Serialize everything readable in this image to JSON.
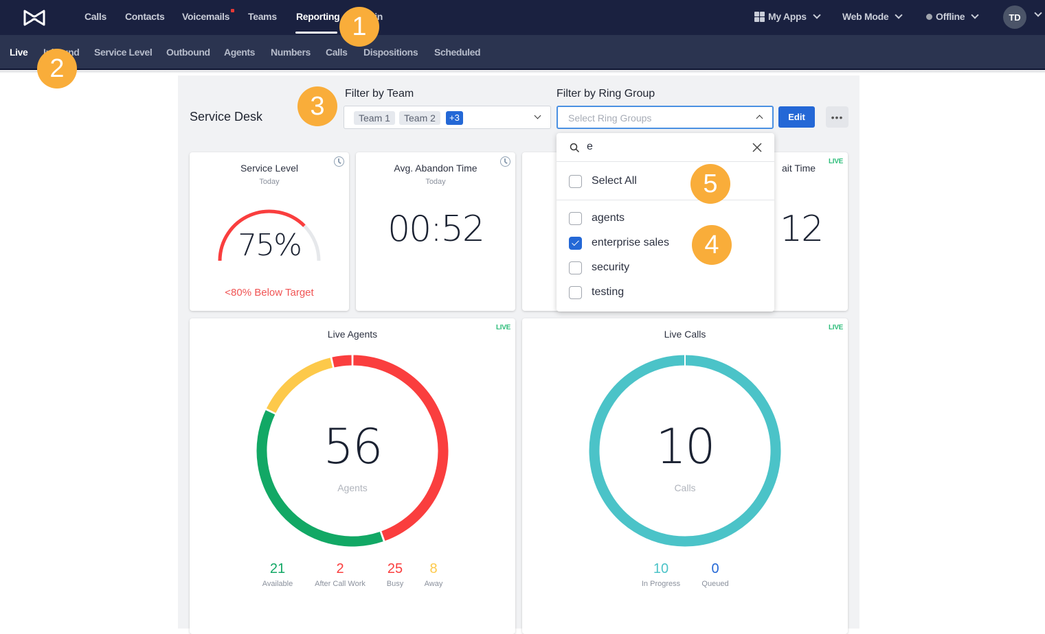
{
  "topnav": {
    "items": [
      {
        "label": "Calls"
      },
      {
        "label": "Contacts"
      },
      {
        "label": "Voicemails",
        "has_notification": true
      },
      {
        "label": "Teams"
      },
      {
        "label": "Reporting",
        "active": true
      },
      {
        "label": "Admin"
      }
    ],
    "my_apps": "My Apps",
    "web_mode": "Web Mode",
    "status": "Offline",
    "avatar_initials": "TD"
  },
  "subnav": {
    "items": [
      {
        "label": "Live",
        "active": true
      },
      {
        "label": "Inbound"
      },
      {
        "label": "Service Level"
      },
      {
        "label": "Outbound"
      },
      {
        "label": "Agents"
      },
      {
        "label": "Numbers"
      },
      {
        "label": "Calls"
      },
      {
        "label": "Dispositions"
      },
      {
        "label": "Scheduled"
      }
    ]
  },
  "page": {
    "title": "Service Desk",
    "filter_team": {
      "label": "Filter by Team",
      "chips": [
        "Team 1",
        "Team 2"
      ],
      "more_count": "+3"
    },
    "filter_ring_group": {
      "label": "Filter by Ring Group",
      "placeholder": "Select Ring Groups"
    },
    "edit_label": "Edit",
    "more_label": "•••"
  },
  "dropdown": {
    "search_value": "e",
    "select_all": "Select All",
    "options": [
      {
        "label": "agents",
        "checked": false
      },
      {
        "label": "enterprise sales",
        "checked": true
      },
      {
        "label": "security",
        "checked": false
      },
      {
        "label": "testing",
        "checked": false
      }
    ]
  },
  "cards": {
    "service_level": {
      "title": "Service Level",
      "subtitle": "Today",
      "value": "75%",
      "percent": 75,
      "target_text": "<80% Below Target"
    },
    "avg_abandon": {
      "title": "Avg. Abandon Time",
      "subtitle": "Today",
      "value": "00:52"
    },
    "wait_time": {
      "title_partial": "ait Time",
      "live": "LIVE",
      "value_partial": "12"
    },
    "live_agents": {
      "title": "Live Agents",
      "live": "LIVE",
      "total": "56",
      "unit": "Agents",
      "segments": [
        {
          "name": "Busy",
          "value": 25,
          "color": "#fa3e3e"
        },
        {
          "name": "Available",
          "value": 21,
          "color": "#12a865"
        },
        {
          "name": "Away",
          "value": 8,
          "color": "#fdc94a"
        },
        {
          "name": "After Call Work",
          "value": 2,
          "color": "#fa3e3e"
        }
      ],
      "stats": [
        {
          "value": "21",
          "label": "Available",
          "color": "#12a865"
        },
        {
          "value": "2",
          "label": "After Call Work",
          "color": "#fa3e3e"
        },
        {
          "value": "25",
          "label": "Busy",
          "color": "#fa3e3e"
        },
        {
          "value": "8",
          "label": "Away",
          "color": "#fdc94a"
        }
      ]
    },
    "live_calls": {
      "title": "Live Calls",
      "live": "LIVE",
      "total": "10",
      "unit": "Calls",
      "segments": [
        {
          "name": "In Progress",
          "value": 10,
          "color": "#4bc3c8"
        },
        {
          "name": "Queued",
          "value": 0,
          "color": "#2468d6"
        }
      ],
      "stats": [
        {
          "value": "10",
          "label": "In Progress",
          "color": "#4bc3c8"
        },
        {
          "value": "0",
          "label": "Queued",
          "color": "#2468d6"
        }
      ]
    }
  },
  "markers": [
    "1",
    "2",
    "3",
    "4",
    "5"
  ]
}
